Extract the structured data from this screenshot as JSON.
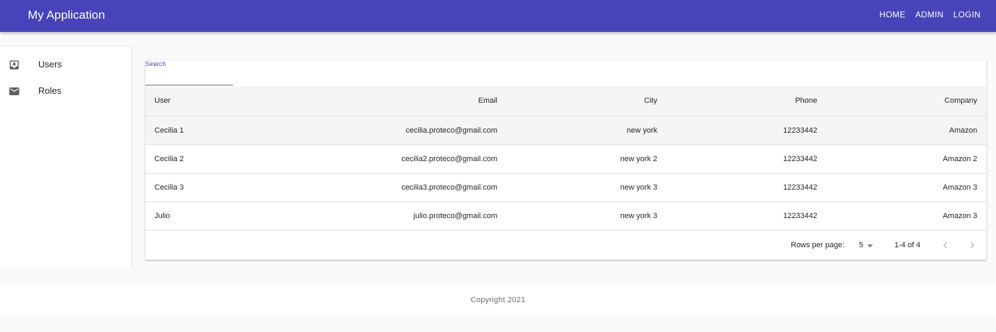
{
  "appbar": {
    "title": "My Application",
    "nav": [
      "HOME",
      "ADMIN",
      "LOGIN"
    ]
  },
  "sidebar": {
    "items": [
      {
        "label": "Users",
        "icon": "inbox-download-icon"
      },
      {
        "label": "Roles",
        "icon": "mail-icon"
      }
    ]
  },
  "search": {
    "label": "Search",
    "value": "",
    "placeholder": ""
  },
  "table": {
    "columns": [
      "User",
      "Email",
      "City",
      "Phone",
      "Company"
    ],
    "rows": [
      [
        "Cecilia 1",
        "cecilia.proteco@gmail.com",
        "new york",
        "12233442",
        "Amazon"
      ],
      [
        "Cecilia 2",
        "cecilia2.proteco@gmail.com",
        "new york 2",
        "12233442",
        "Amazon 2"
      ],
      [
        "Cecilia 3",
        "cecilia3.proteco@gmail.com",
        "new york 3",
        "12233442",
        "Amazon 3"
      ],
      [
        "Julio",
        "julio.proteco@gmail.com",
        "new york 3",
        "12233442",
        "Amazon 3"
      ]
    ],
    "highlighted_row": 0
  },
  "pagination": {
    "rows_per_page_label": "Rows per page:",
    "rows_per_page": "5",
    "range": "1-4 of 4"
  },
  "footer": {
    "copyright": "Copyright 2021"
  },
  "colors": {
    "primary": "#4743b9",
    "icon": "#5f5f5f"
  }
}
